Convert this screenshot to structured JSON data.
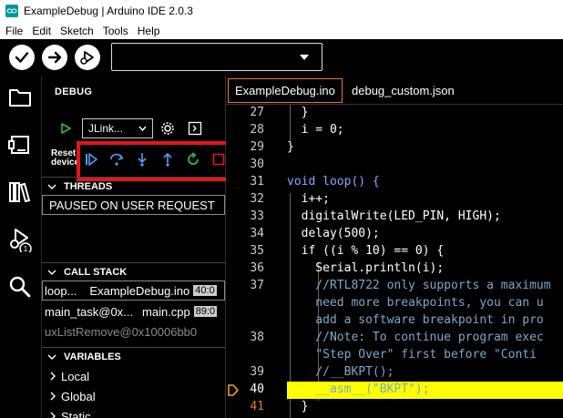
{
  "window": {
    "title": "ExampleDebug | Arduino IDE 2.0.3"
  },
  "menu": [
    "File",
    "Edit",
    "Sketch",
    "Tools",
    "Help"
  ],
  "toolbar": {
    "board_value": ""
  },
  "sidebar": {
    "title": "DEBUG",
    "debugger_select": "JLink...",
    "reset_device_line1": "Reset",
    "reset_device_line2": "device",
    "threads": {
      "header": "THREADS",
      "items": [
        "PAUSED ON USER REQUEST"
      ]
    },
    "call_stack": {
      "header": "CALL STACK",
      "frames": [
        {
          "func": "loop...",
          "file": "ExampleDebug.ino",
          "pos": "40:0"
        },
        {
          "func": "main_task@0x...",
          "file": "main.cpp",
          "pos": "89:0"
        },
        {
          "func": "uxListRemove@0x10006bb0",
          "file": "",
          "pos": ""
        }
      ]
    },
    "variables": {
      "header": "VARIABLES",
      "items": [
        "Local",
        "Global",
        "Static"
      ]
    }
  },
  "tabs": [
    {
      "label": "ExampleDebug.ino",
      "active": true
    },
    {
      "label": "debug_custom.json",
      "active": false
    }
  ],
  "editor": {
    "lines": [
      {
        "n": "27",
        "text": "  }"
      },
      {
        "n": "28",
        "text": "  i = 0;"
      },
      {
        "n": "29",
        "text": "}"
      },
      {
        "n": "30",
        "text": ""
      },
      {
        "n": "31",
        "text": "void loop() {"
      },
      {
        "n": "32",
        "text": "  i++;"
      },
      {
        "n": "33",
        "text": "  digitalWrite(LED_PIN, HIGH);"
      },
      {
        "n": "34",
        "text": "  delay(500);"
      },
      {
        "n": "35",
        "text": "  if ((i % 10) == 0) {"
      },
      {
        "n": "36",
        "text": "    Serial.println(i);"
      },
      {
        "n": "37",
        "text": "    //RTL8722 only supports a maximum"
      },
      {
        "n": "",
        "text": "    need more breakpoints, you can u"
      },
      {
        "n": "",
        "text": "    add a software breakpoint in pro"
      },
      {
        "n": "38",
        "text": "    //Note: To continue program exec"
      },
      {
        "n": "",
        "text": "    \"Step Over\" first before \"Conti"
      },
      {
        "n": "39",
        "text": "    //__BKPT();"
      },
      {
        "n": "40",
        "text": "    __asm__(\"BKPT\");"
      },
      {
        "n": "41",
        "text": "  }"
      }
    ],
    "current_line": "40"
  },
  "colors": {
    "highlight": "#ffff00",
    "focus_box": "#e2161c",
    "debug_blue": "#4aa3ff",
    "debug_green": "#2fb84a",
    "tab_border": "#e8762d",
    "current_arrow": "#f5a623"
  }
}
